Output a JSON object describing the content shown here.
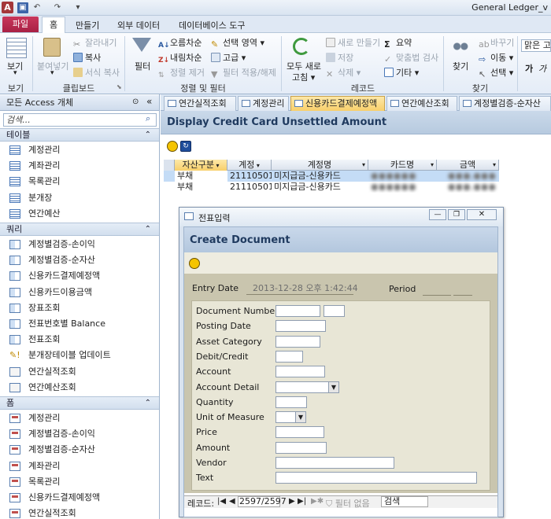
{
  "window": {
    "title": "General Ledger_v",
    "app_icon": "A",
    "quick_access": [
      "save-icon",
      "undo-icon",
      "redo-icon",
      "customize-icon"
    ]
  },
  "ribbon": {
    "file_tab": "파일",
    "tabs": [
      "홈",
      "만들기",
      "외부 데이터",
      "데이터베이스 도구"
    ],
    "groups": {
      "view": {
        "label": "보기",
        "button": "보기"
      },
      "clipboard": {
        "label": "클립보드",
        "paste": "붙여넣기",
        "cut": "잘라내기",
        "copy": "복사",
        "format_painter": "서식 복사"
      },
      "sort_filter": {
        "label": "정렬 및 필터",
        "filter": "필터",
        "ascending": "오름차순",
        "descending": "내림차순",
        "remove_sort": "정렬 제거",
        "selection": "선택 영역",
        "advanced": "고급",
        "toggle_filter": "필터 적용/해제"
      },
      "records": {
        "label": "레코드",
        "refresh": "모두 새로",
        "refresh2": "고침",
        "new": "새로 만들기",
        "save": "저장",
        "delete": "삭제",
        "totals": "요약",
        "spelling": "맞춤법 검사",
        "more": "기타"
      },
      "find": {
        "label": "찾기",
        "find": "찾기",
        "replace": "바꾸기",
        "goto": "이동",
        "select": "선택"
      },
      "text": {
        "font": "맑은 고",
        "bold": "가",
        "italic": "가"
      }
    }
  },
  "nav": {
    "header": "모든 Access 개체",
    "search_placeholder": "검색...",
    "sections": [
      {
        "title": "테이블",
        "items": [
          "계정관리",
          "계좌관리",
          "목록관리",
          "분개장",
          "연간예산"
        ]
      },
      {
        "title": "쿼리",
        "items": [
          "계정별검증-손이익",
          "계정별검증-순자산",
          "신용카드결제예정액",
          "신용카드이용금액",
          "장표조회",
          "전표번호별 Balance",
          "전표조회",
          "분개장테이블 업데이트",
          "연간실적조회",
          "연간예산조회"
        ]
      },
      {
        "title": "폼",
        "items": [
          "계정관리",
          "계정별검증-손이익",
          "계정별검증-순자산",
          "계좌관리",
          "목록관리",
          "신용카드결제예정액",
          "연간실적조회"
        ]
      }
    ]
  },
  "doc_tabs": [
    "연간실적조회",
    "계정관리",
    "신용카드결제예정액",
    "연간예산조회",
    "계정별검증-순자산"
  ],
  "main_form": {
    "title": "Display Credit Card Unsettled Amount",
    "columns": [
      "자산구분",
      "계정",
      "계정명",
      "카드명",
      "금액"
    ],
    "rows": [
      {
        "asset": "부채",
        "account": "21110501",
        "account_name": "미지급금-신용카드",
        "card": "●●●●●●",
        "amount": "●●●,●●●"
      },
      {
        "asset": "부채",
        "account": "21110501",
        "account_name": "미지급금-신용카드",
        "card": "●●●●●●",
        "amount": "●●●,●●●"
      }
    ]
  },
  "dialog": {
    "title": "전표입력",
    "header": "Create Document",
    "entry_date_label": "Entry Date",
    "entry_date_value": "2013-12-28 오후 1:42:44",
    "period_label": "Period",
    "fields": [
      "Document Number",
      "Posting Date",
      "Asset Category",
      "Debit/Credit",
      "Account",
      "Account Detail",
      "Quantity",
      "Unit of Measure",
      "Price",
      "Amount",
      "Vendor",
      "Text"
    ],
    "record_nav": {
      "label": "레코드:",
      "position": "2597/2597",
      "filter": "필터 없음",
      "search": "검색"
    }
  }
}
